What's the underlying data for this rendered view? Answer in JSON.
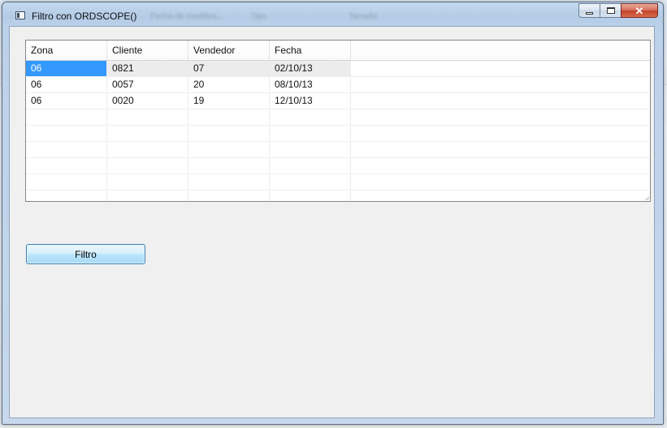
{
  "window": {
    "title": "Filtro con ORDSCOPE()",
    "background_ghost": [
      "Fecha de modifica...",
      "Tipo",
      "Tamaño"
    ]
  },
  "grid": {
    "columns": [
      "Zona",
      "Cliente",
      "Vendedor",
      "Fecha"
    ],
    "rows": [
      [
        "06",
        "0821",
        "07",
        "02/10/13"
      ],
      [
        "06",
        "0057",
        "20",
        "08/10/13"
      ],
      [
        "06",
        "0020",
        "19",
        "12/10/13"
      ]
    ],
    "empty_rows": 6
  },
  "buttons": {
    "filtro_label": "Filtro"
  },
  "colors": {
    "selection": "#3399ff",
    "client_bg": "#f0f0f0",
    "close_button": "#c1412b"
  }
}
